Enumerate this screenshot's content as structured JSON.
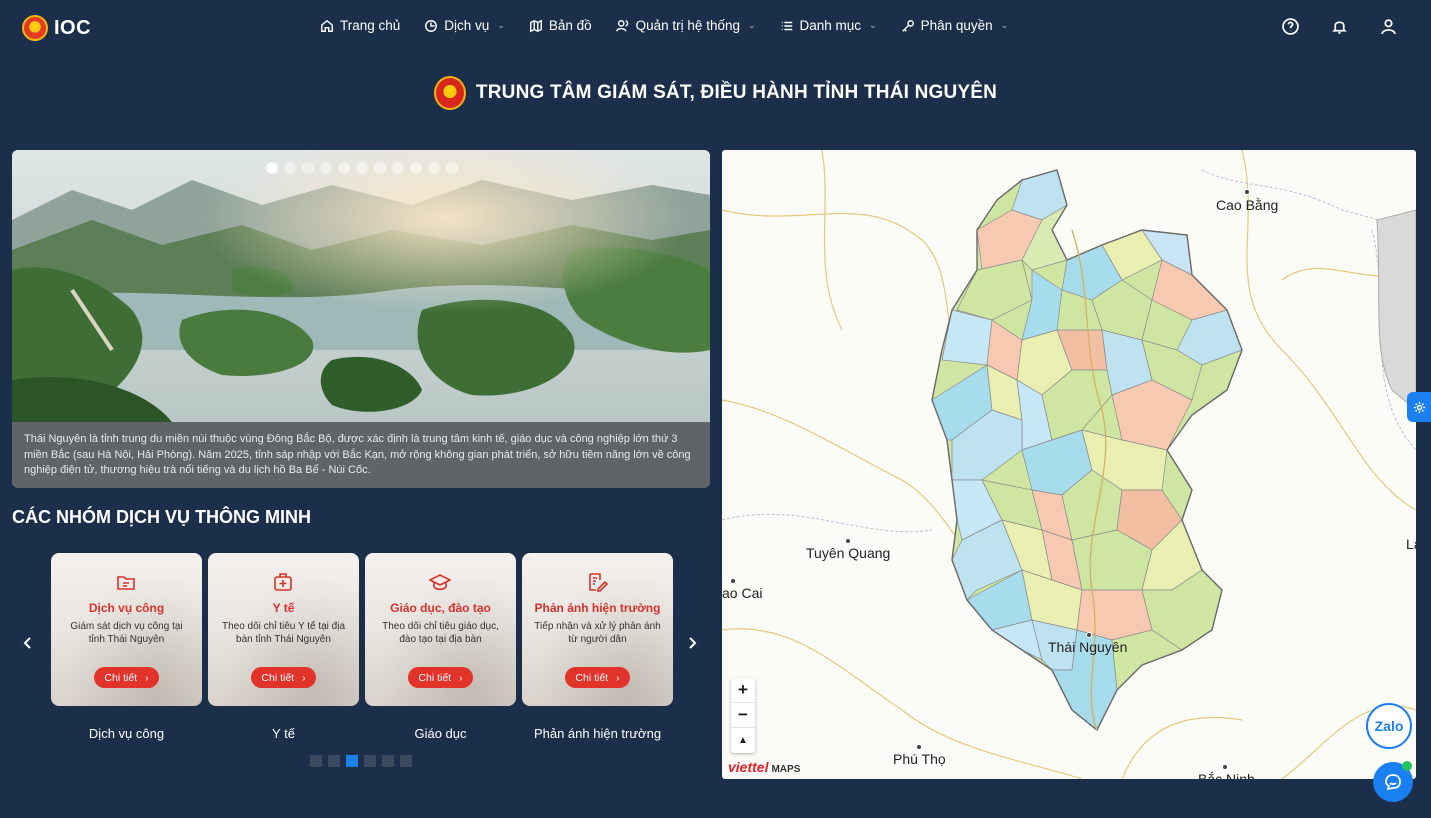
{
  "app": {
    "logo_text": "IOC"
  },
  "nav": [
    {
      "label": "Trang chủ",
      "icon": "home-icon",
      "has_dropdown": false
    },
    {
      "label": "Dịch vụ",
      "icon": "clock-icon",
      "has_dropdown": true
    },
    {
      "label": "Bản đồ",
      "icon": "map-icon",
      "has_dropdown": false
    },
    {
      "label": "Quản trị hệ thống",
      "icon": "users-icon",
      "has_dropdown": true
    },
    {
      "label": "Danh mục",
      "icon": "list-icon",
      "has_dropdown": true
    },
    {
      "label": "Phân quyền",
      "icon": "key-icon",
      "has_dropdown": true
    }
  ],
  "header_icons": [
    "help-icon",
    "bell-icon",
    "user-icon"
  ],
  "page": {
    "title": "TRUNG TÂM GIÁM SÁT, ĐIỀU HÀNH TỈNH THÁI NGUYÊN"
  },
  "hero": {
    "caption": "Thái Nguyên là tỉnh trung du miền núi thuộc vùng Đông Bắc Bộ, được xác định là trung tâm kinh tế, giáo dục và công nghiệp lớn thứ 3 miền Bắc (sau Hà Nội, Hải Phòng). Năm 2025, tỉnh sáp nhập với Bắc Kạn, mở rộng không gian phát triển, sở hữu tiềm năng lớn về công nghiệp điện tử, thương hiệu trà nổi tiếng và du lịch hồ Ba Bể - Núi Cốc.",
    "slide_count": 11,
    "active_slide": 0
  },
  "services": {
    "title": "CÁC NHÓM DỊCH VỤ THÔNG MINH",
    "cards": [
      {
        "title": "Dịch vụ công",
        "desc": "Giám sát dịch vụ công tại tỉnh Thái Nguyên",
        "button": "Chi tiết",
        "label": "Dịch vụ công",
        "icon": "document-folder-icon"
      },
      {
        "title": "Y tế",
        "desc": "Theo dõi chỉ tiêu Y tế tại địa bàn tỉnh Thái Nguyên",
        "button": "Chi tiết",
        "label": "Y tế",
        "icon": "medical-kit-icon"
      },
      {
        "title": "Giáo dục, đào tạo",
        "desc": "Theo dõi chỉ tiêu giáo dục, đào tạo tại địa bàn",
        "button": "Chi tiết",
        "label": "Giáo dục",
        "icon": "graduation-cap-icon"
      },
      {
        "title": "Phản ánh hiện trường",
        "desc": "Tiếp nhận và xử lý phản ánh từ người dân",
        "button": "Chi tiết",
        "label": "Phản ánh hiện trường",
        "icon": "edit-note-icon"
      }
    ],
    "page_count": 6,
    "active_page": 2
  },
  "map": {
    "labels": [
      "Cao Bằng",
      "Tuyên Quang",
      "ao Cai",
      "Thái Nguyên",
      "Phú Thọ",
      "Bắc Ninh",
      "La"
    ],
    "zoom_in": "+",
    "zoom_out": "−",
    "reset": "▲",
    "brand": "viettel",
    "brand_suffix": "MAPS"
  },
  "widgets": {
    "zalo": "Zalo"
  }
}
